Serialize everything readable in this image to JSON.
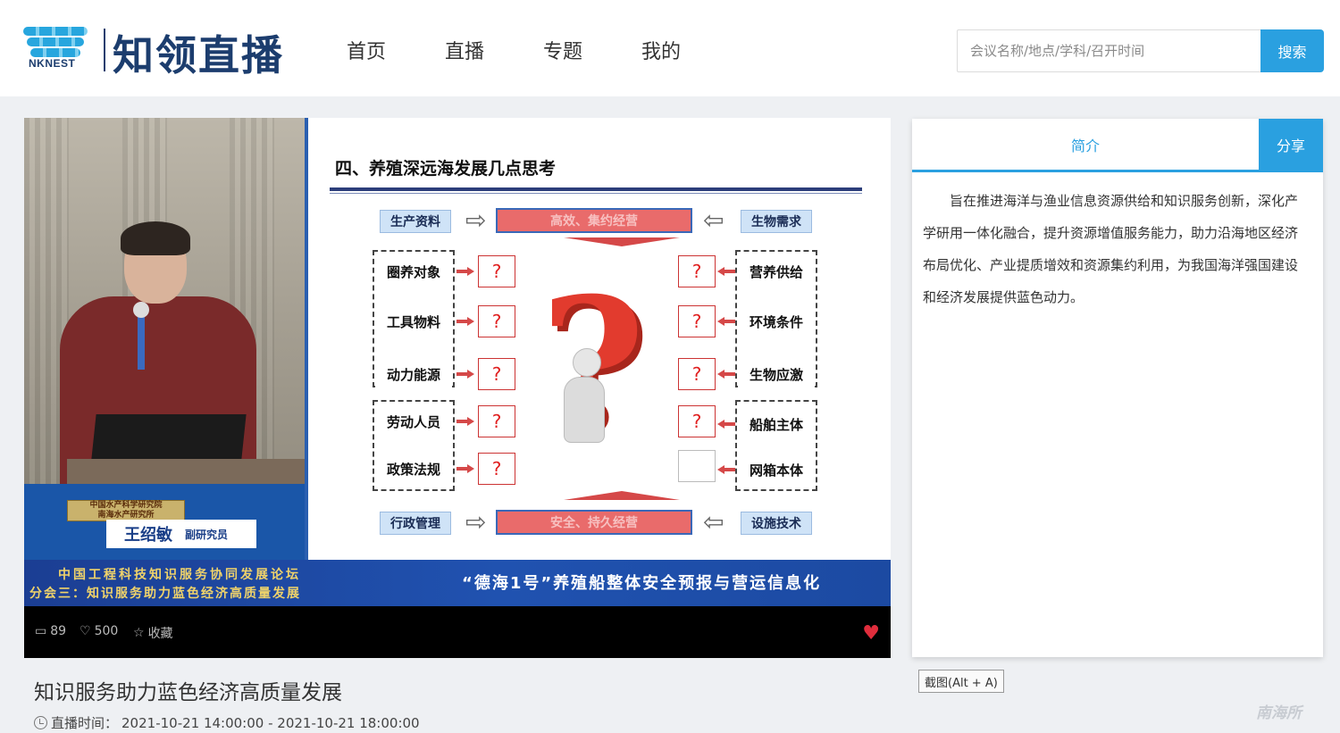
{
  "header": {
    "logo_sub": "NKNEST",
    "logo_title": "知领直播",
    "nav": [
      "首页",
      "直播",
      "专题",
      "我的"
    ],
    "search_placeholder": "会议名称/地点/学科/召开时间",
    "search_button": "搜索"
  },
  "player": {
    "speaker": {
      "institution_line1": "中国水产科学研究院",
      "institution_line2": "南海水产研究所",
      "name": "王绍敏",
      "title": "副研究员"
    },
    "slide": {
      "title": "四、养殖深远海发展几点思考",
      "top_bar": "高效、集约经营",
      "bottom_bar": "安全、持久经营",
      "corner_tags": [
        "生产资料",
        "生物需求",
        "行政管理",
        "设施技术"
      ],
      "left_items": [
        "圈养对象",
        "工具物料",
        "动力能源",
        "劳动人员",
        "政策法规"
      ],
      "right_items": [
        "营养供给",
        "环境条件",
        "生物应激",
        "船舶主体",
        "网箱本体"
      ],
      "question": "?",
      "big_question": "?"
    },
    "banner": {
      "left_line1": "中国工程科技知识服务协同发展论坛",
      "left_line2": "分会三：知识服务助力蓝色经济高质量发展",
      "right": "“德海1号”养殖船整体安全预报与营运信息化"
    },
    "controls": {
      "comments": "89",
      "likes": "500",
      "favorite": "收藏"
    }
  },
  "panel": {
    "tab_intro": "简介",
    "tab_share": "分享",
    "intro": "旨在推进海洋与渔业信息资源供给和知识服务创新，深化产学研用一体化融合，提升资源增值服务能力，助力沿海地区经济布局优化、产业提质增效和资源集约利用，为我国海洋强国建设和经济发展提供蓝色动力。"
  },
  "screenshot_hint": "截图(Alt + A)",
  "video": {
    "title": "知识服务助力蓝色经济高质量发展",
    "time_label": "直播时间：",
    "time_range": "2021-10-21 14:00:00 - 2021-10-21 18:00:00"
  },
  "watermark": "南海所",
  "colors": {
    "accent": "#2aa0e0",
    "brand": "#1c3d6e",
    "banner": "#1b3e93",
    "question_red": "#e23b2e"
  }
}
